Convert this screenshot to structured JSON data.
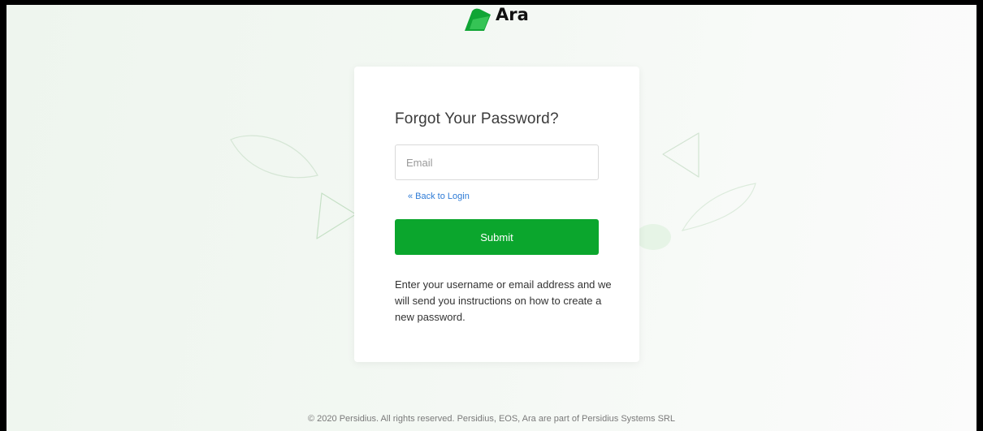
{
  "brand": {
    "name": "Ara",
    "logo_icon": "ara-leaf-logo",
    "primary_color": "#0ba62d"
  },
  "form": {
    "title": "Forgot Your Password?",
    "email_placeholder": "Email",
    "email_value": "",
    "back_link": "« Back to Login",
    "submit_label": "Submit",
    "help_text": "Enter your username or email address and we will send you instructions on how to create a new password."
  },
  "footer": {
    "copyright": "© 2020 Persidius. All rights reserved. Persidius, EOS, Ara are part of Persidius Systems SRL"
  }
}
